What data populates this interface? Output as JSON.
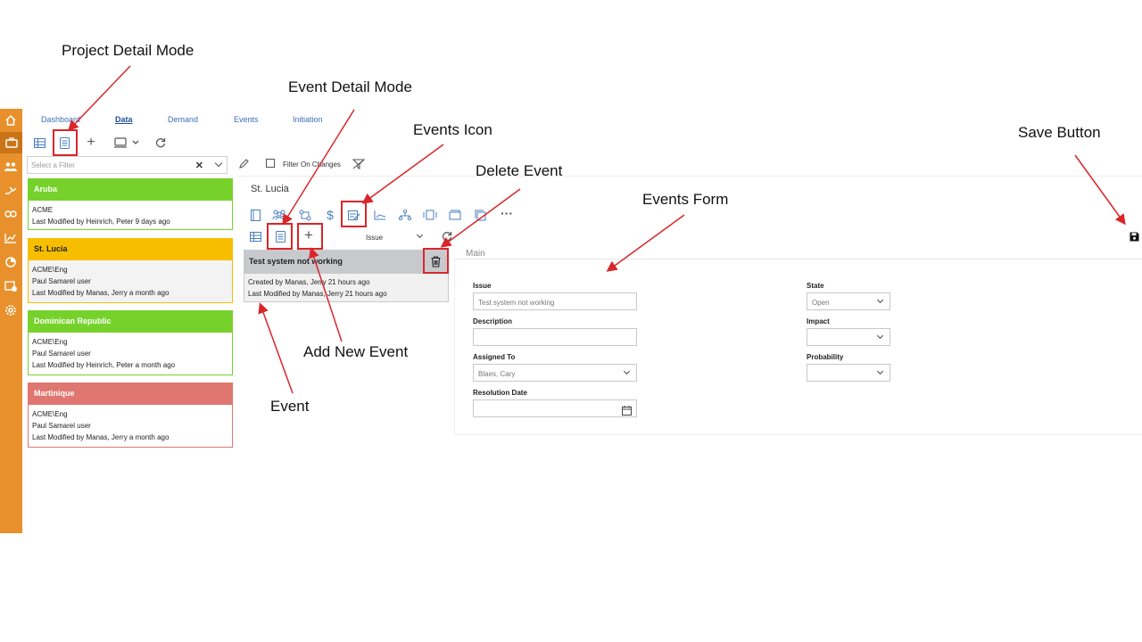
{
  "annotations": {
    "project_detail_mode": "Project Detail Mode",
    "event_detail_mode": "Event Detail Mode",
    "events_icon": "Events Icon",
    "delete_event": "Delete Event",
    "events_form": "Events Form",
    "save_button": "Save Button",
    "add_new_event": "Add New Event",
    "event": "Event"
  },
  "nav": {
    "tabs": [
      {
        "label": "Dashboard"
      },
      {
        "label": "Data"
      },
      {
        "label": "Demand"
      },
      {
        "label": "Events"
      },
      {
        "label": "Initiation"
      }
    ],
    "active": "Data"
  },
  "filter": {
    "placeholder": "Select a Filter",
    "filter_on_changes": "Filter On Changes"
  },
  "projects": [
    {
      "name": "Aruba",
      "color": "#76d22b",
      "lines": [
        "ACME",
        "Last Modified by Heinrich, Peter 9 days ago"
      ]
    },
    {
      "name": "St. Lucia",
      "color": "#f7be00",
      "lines": [
        "ACME\\Eng",
        "Paul Samarel user",
        "Last Modified by Manas, Jerry a month ago"
      ]
    },
    {
      "name": "Dominican Republic",
      "color": "#76d22b",
      "lines": [
        "ACME\\Eng",
        "Paul Samarel user",
        "Last Modified by Heinrich, Peter a month ago"
      ]
    },
    {
      "name": "Martinique",
      "color": "#e07670",
      "lines": [
        "ACME\\Eng",
        "Paul Samarel user",
        "Last Modified by Manas, Jerry a month ago"
      ]
    }
  ],
  "detail": {
    "title": "St. Lucia",
    "type_selector": "Issue"
  },
  "event": {
    "title": "Test system not working",
    "created": "Created by Manas, Jerry 21 hours ago",
    "modified": "Last Modified by Manas, Jerry 21 hours ago"
  },
  "form": {
    "section": "Main",
    "issue_label": "Issue",
    "issue_value": "Test system not working",
    "description_label": "Description",
    "assigned_label": "Assigned To",
    "assigned_value": "Blaes, Cary",
    "resolution_label": "Resolution Date",
    "state_label": "State",
    "state_value": "Open",
    "impact_label": "Impact",
    "probability_label": "Probability"
  },
  "colors": {
    "rail": "#e8912c",
    "highlight": "#d9262a",
    "link": "#3b6fb6"
  }
}
